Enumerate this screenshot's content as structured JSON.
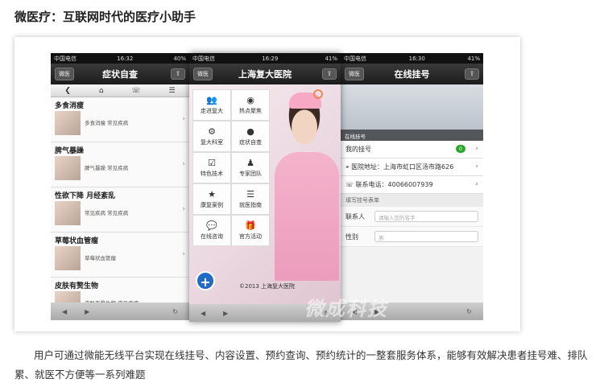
{
  "page_title": "微医疗：互联网时代的医疗小助手",
  "caption": "用户可通过微能无线平台实现在线挂号、内容设置、预约查询、预约统计的一整套服务体系，能够有效解决患者挂号难、排队累、就医不方便等一系列难题",
  "watermark": "微成科技",
  "phones": {
    "left": {
      "status": {
        "carrier": "中国电信",
        "time": "16:32",
        "battery": "40%"
      },
      "back_label": "微医",
      "title": "症状自查",
      "items": [
        {
          "name": "多食消瘦",
          "desc": "多食消瘦  常见疾病"
        },
        {
          "name": "脾气暴躁",
          "desc": "脾气暴躁  常见疾病"
        },
        {
          "name": "性欲下降 月经紊乱",
          "desc": "常见疾病  常见疾病"
        },
        {
          "name": "草莓状血管瘤",
          "desc": "草莓状血管瘤"
        },
        {
          "name": "皮肤有赘生物",
          "desc": "皮肤有赘生物  常见疾病"
        }
      ]
    },
    "center": {
      "status": {
        "carrier": "中国电信",
        "time": "16:29",
        "battery": "41%"
      },
      "back_label": "微医",
      "title": "上海复大医院",
      "menu": [
        {
          "label": "走进复大",
          "icon": "people-icon"
        },
        {
          "label": "热点聚焦",
          "icon": "rss-icon"
        },
        {
          "label": "复大科室",
          "icon": "gears-icon"
        },
        {
          "label": "症状自查",
          "icon": "user-icon"
        },
        {
          "label": "特色技术",
          "icon": "checkbox-icon"
        },
        {
          "label": "专家团队",
          "icon": "doctor-icon"
        },
        {
          "label": "康复案例",
          "icon": "star-icon"
        },
        {
          "label": "就医指南",
          "icon": "list-icon"
        },
        {
          "label": "在线咨询",
          "icon": "chat-icon"
        },
        {
          "label": "官方活动",
          "icon": "gift-icon"
        }
      ],
      "copyright": "©2013 上海复大医院"
    },
    "right": {
      "status": {
        "carrier": "中国电信",
        "time": "16:30",
        "battery": "41%"
      },
      "back_label": "微医",
      "title": "在线挂号",
      "hero_caption": "在线挂号",
      "my_reg_label": "我的挂号",
      "my_reg_count": "0",
      "address": "医院地址：上海市虹口区汤市路626",
      "phone": "联系电话：40066007939",
      "section_title": "填写挂号表单",
      "form": [
        {
          "label": "联系人",
          "placeholder": "请输入您的名字"
        },
        {
          "label": "性别",
          "placeholder": "男"
        }
      ]
    }
  },
  "colors": {
    "accent_blue": "#1f6bc5",
    "badge_green": "#2aa62a",
    "nurse_pink": "#f4b3cb"
  }
}
